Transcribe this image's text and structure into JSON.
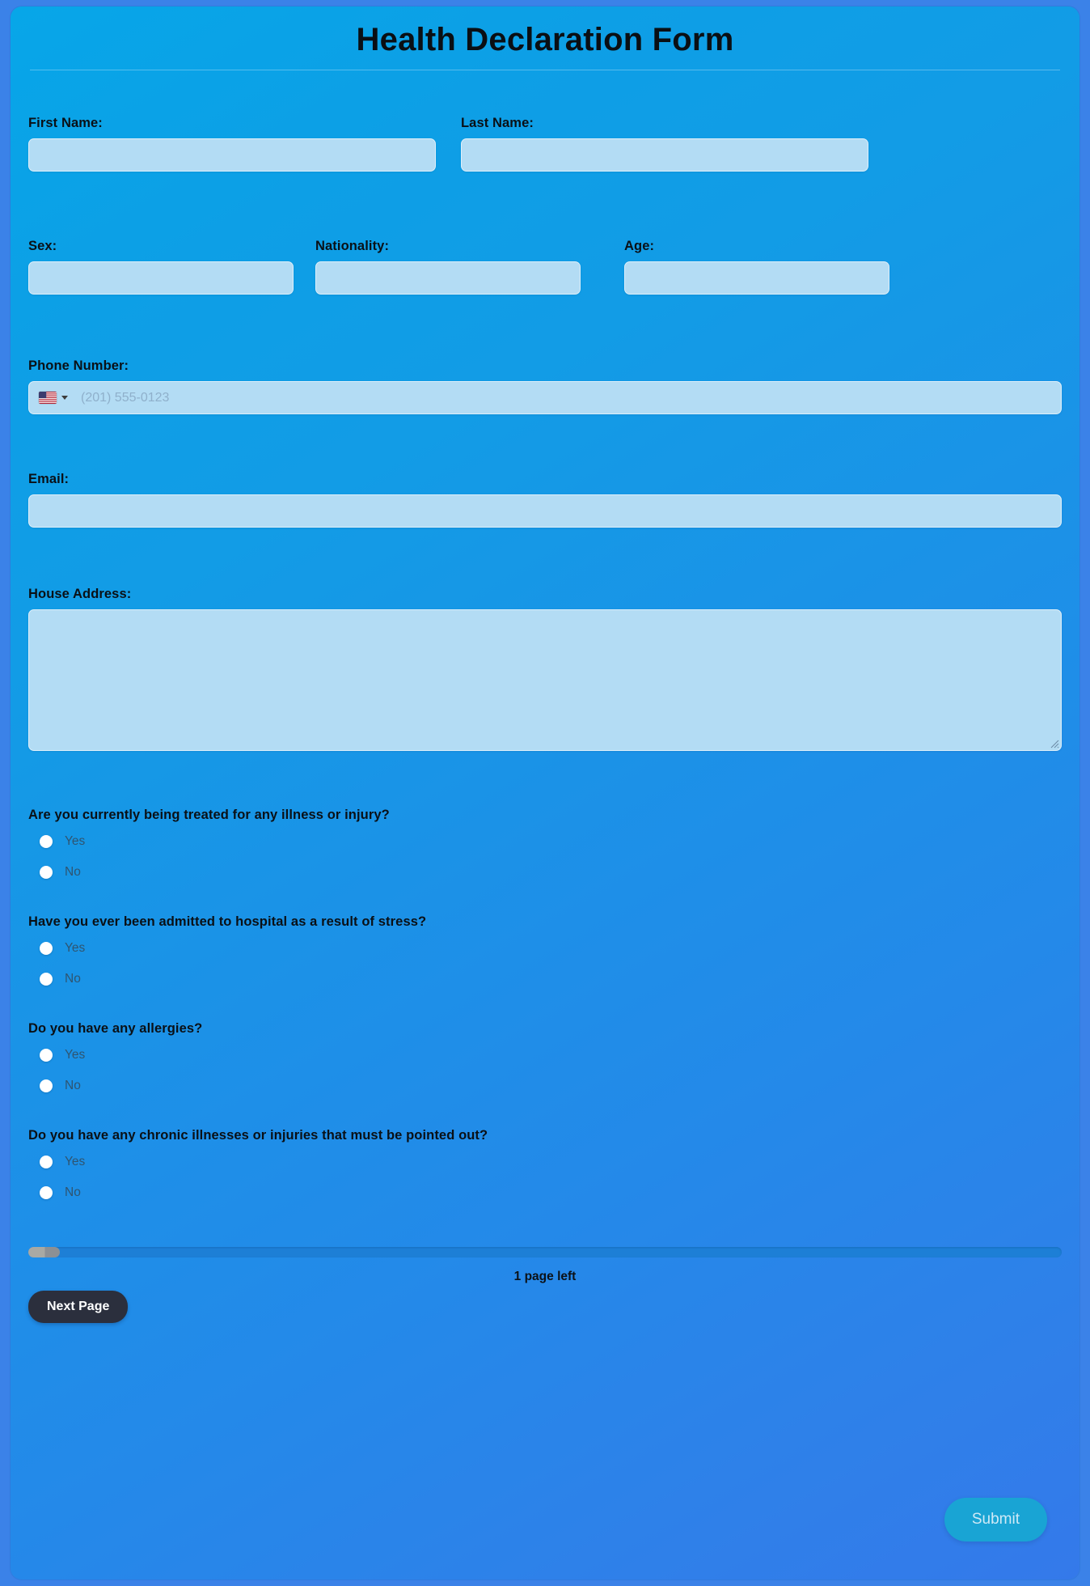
{
  "form": {
    "title": "Health Declaration Form"
  },
  "fields": {
    "first_name": {
      "label": "First Name:",
      "value": "",
      "placeholder": ""
    },
    "last_name": {
      "label": "Last Name:",
      "value": "",
      "placeholder": ""
    },
    "sex": {
      "label": "Sex:",
      "value": "",
      "placeholder": ""
    },
    "nationality": {
      "label": "Nationality:",
      "value": "",
      "placeholder": ""
    },
    "age": {
      "label": "Age:",
      "value": "",
      "placeholder": ""
    },
    "phone": {
      "label": "Phone Number:",
      "value": "",
      "placeholder": "(201) 555-0123",
      "country_flag": "us-flag-icon",
      "dropdown_icon": "chevron-down-icon"
    },
    "email": {
      "label": "Email:",
      "value": "",
      "placeholder": ""
    },
    "address": {
      "label": "House Address:",
      "value": "",
      "placeholder": ""
    }
  },
  "questions": [
    {
      "text": "Are you currently being treated for any illness or injury?",
      "options": [
        {
          "label": "Yes"
        },
        {
          "label": "No"
        }
      ]
    },
    {
      "text": "Have you ever been admitted to hospital as a result of stress?",
      "options": [
        {
          "label": "Yes"
        },
        {
          "label": "No"
        }
      ]
    },
    {
      "text": "Do you have any allergies?",
      "options": [
        {
          "label": "Yes"
        },
        {
          "label": "No"
        }
      ]
    },
    {
      "text": "Do you have any chronic illnesses or injuries that must be pointed out?",
      "options": [
        {
          "label": "Yes"
        },
        {
          "label": "No"
        }
      ]
    }
  ],
  "footer": {
    "pages_left": "1 page left",
    "next_page_label": "Next Page",
    "submit_label": "Submit",
    "progress_percent": 3
  },
  "colors": {
    "card_top": "#07a6e8",
    "card_bottom": "#3479ea",
    "page_background": "#3b82e8",
    "input_fill": "#b3dcf4",
    "next_button": "#2b2f3d",
    "submit_button": "#19a4d4",
    "progress_track": "#1d7fd6",
    "progress_thumb": "#a8a9a4",
    "label_text": "#0a1016",
    "option_text": "#2f5571"
  }
}
